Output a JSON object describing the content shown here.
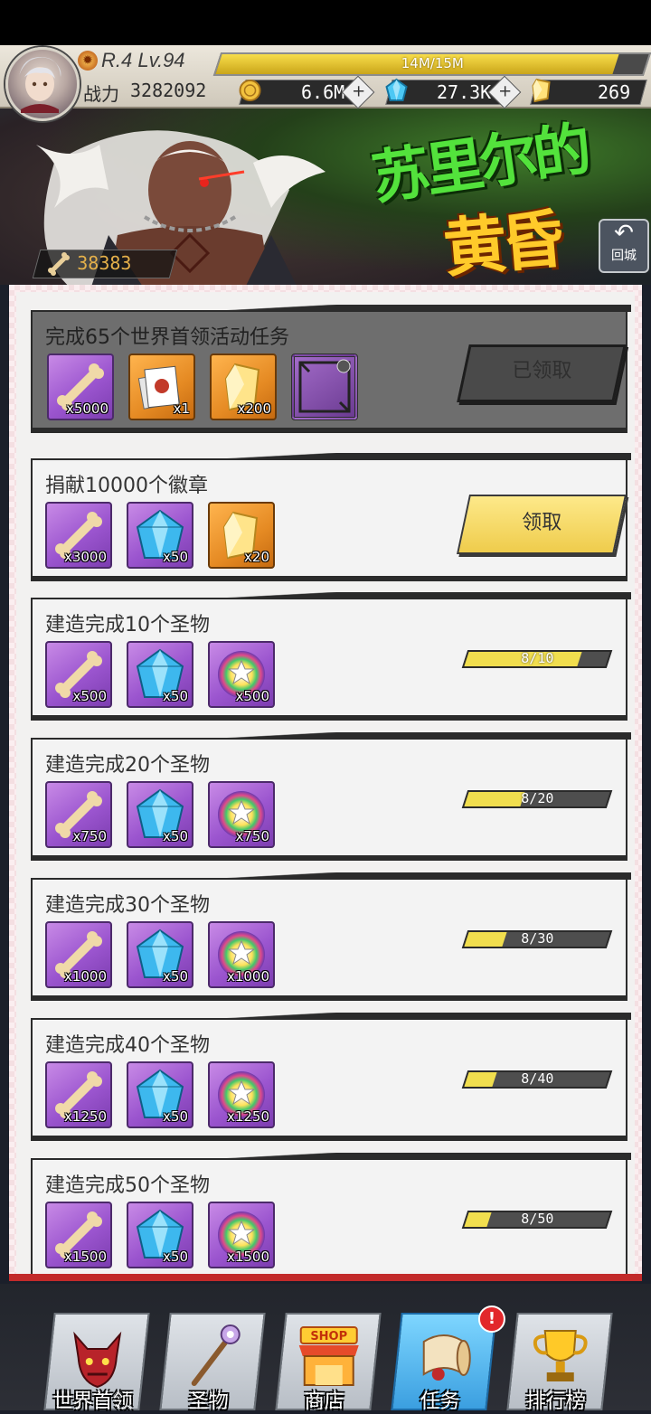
{
  "header": {
    "rank_level": "R.4 Lv.94",
    "xp_text": "14M/15M",
    "xp_progress": 0.93,
    "power_label": "战力",
    "power_value": "3282092",
    "resources": [
      {
        "icon": "gold-coin-icon",
        "value": "6.6M"
      },
      {
        "icon": "blue-gem-icon",
        "value": "27.3K"
      },
      {
        "icon": "yellow-crystal-icon",
        "value": "269"
      }
    ],
    "event_currency": {
      "icon": "bone-icon",
      "value": "38383"
    },
    "event_title_line1": "苏里尔的",
    "event_title_line2": "黄昏",
    "back_label": "回城"
  },
  "tasks": [
    {
      "title": "完成65个世界首领活动任务",
      "state": "claimed",
      "button_label": "已领取",
      "rewards": [
        {
          "icon": "bone-icon",
          "qty": "x5000"
        },
        {
          "icon": "card-deck-icon",
          "qty": "x1"
        },
        {
          "icon": "yellow-crystal-icon",
          "qty": "x200"
        },
        {
          "icon": "avatar-frame-icon",
          "qty": ""
        }
      ]
    },
    {
      "title": "捐献10000个徽章",
      "state": "claimable",
      "button_label": "领取",
      "rewards": [
        {
          "icon": "bone-icon",
          "qty": "x3000"
        },
        {
          "icon": "blue-gem-icon",
          "qty": "x50"
        },
        {
          "icon": "yellow-crystal-icon",
          "qty": "x20"
        }
      ]
    },
    {
      "title": "建造完成10个圣物",
      "state": "progress",
      "progress_text": "8/10",
      "progress": 0.8,
      "rewards": [
        {
          "icon": "bone-icon",
          "qty": "x500"
        },
        {
          "icon": "blue-gem-icon",
          "qty": "x50"
        },
        {
          "icon": "rainbow-orb-icon",
          "qty": "x500"
        }
      ]
    },
    {
      "title": "建造完成20个圣物",
      "state": "progress",
      "progress_text": "8/20",
      "progress": 0.4,
      "rewards": [
        {
          "icon": "bone-icon",
          "qty": "x750"
        },
        {
          "icon": "blue-gem-icon",
          "qty": "x50"
        },
        {
          "icon": "rainbow-orb-icon",
          "qty": "x750"
        }
      ]
    },
    {
      "title": "建造完成30个圣物",
      "state": "progress",
      "progress_text": "8/30",
      "progress": 0.27,
      "rewards": [
        {
          "icon": "bone-icon",
          "qty": "x1000"
        },
        {
          "icon": "blue-gem-icon",
          "qty": "x50"
        },
        {
          "icon": "rainbow-orb-icon",
          "qty": "x1000"
        }
      ]
    },
    {
      "title": "建造完成40个圣物",
      "state": "progress",
      "progress_text": "8/40",
      "progress": 0.2,
      "rewards": [
        {
          "icon": "bone-icon",
          "qty": "x1250"
        },
        {
          "icon": "blue-gem-icon",
          "qty": "x50"
        },
        {
          "icon": "rainbow-orb-icon",
          "qty": "x1250"
        }
      ]
    },
    {
      "title": "建造完成50个圣物",
      "state": "progress",
      "progress_text": "8/50",
      "progress": 0.16,
      "rewards": [
        {
          "icon": "bone-icon",
          "qty": "x1500"
        },
        {
          "icon": "blue-gem-icon",
          "qty": "x50"
        },
        {
          "icon": "rainbow-orb-icon",
          "qty": "x1500"
        }
      ]
    }
  ],
  "nav": [
    {
      "label": "世界首领",
      "icon": "demon-mask-icon",
      "active": false
    },
    {
      "label": "圣物",
      "icon": "scepter-icon",
      "active": false
    },
    {
      "label": "商店",
      "icon": "shop-stall-icon",
      "active": false,
      "sign": "SHOP"
    },
    {
      "label": "任务",
      "icon": "scroll-icon",
      "active": true,
      "alert": "!"
    },
    {
      "label": "排行榜",
      "icon": "trophy-icon",
      "active": false
    }
  ],
  "colors": {
    "claim_button": "#efcc4c",
    "progress_fill": "#f1de4e",
    "panel_border": "#c22a2a",
    "active_tab": "#3b9fe0"
  }
}
